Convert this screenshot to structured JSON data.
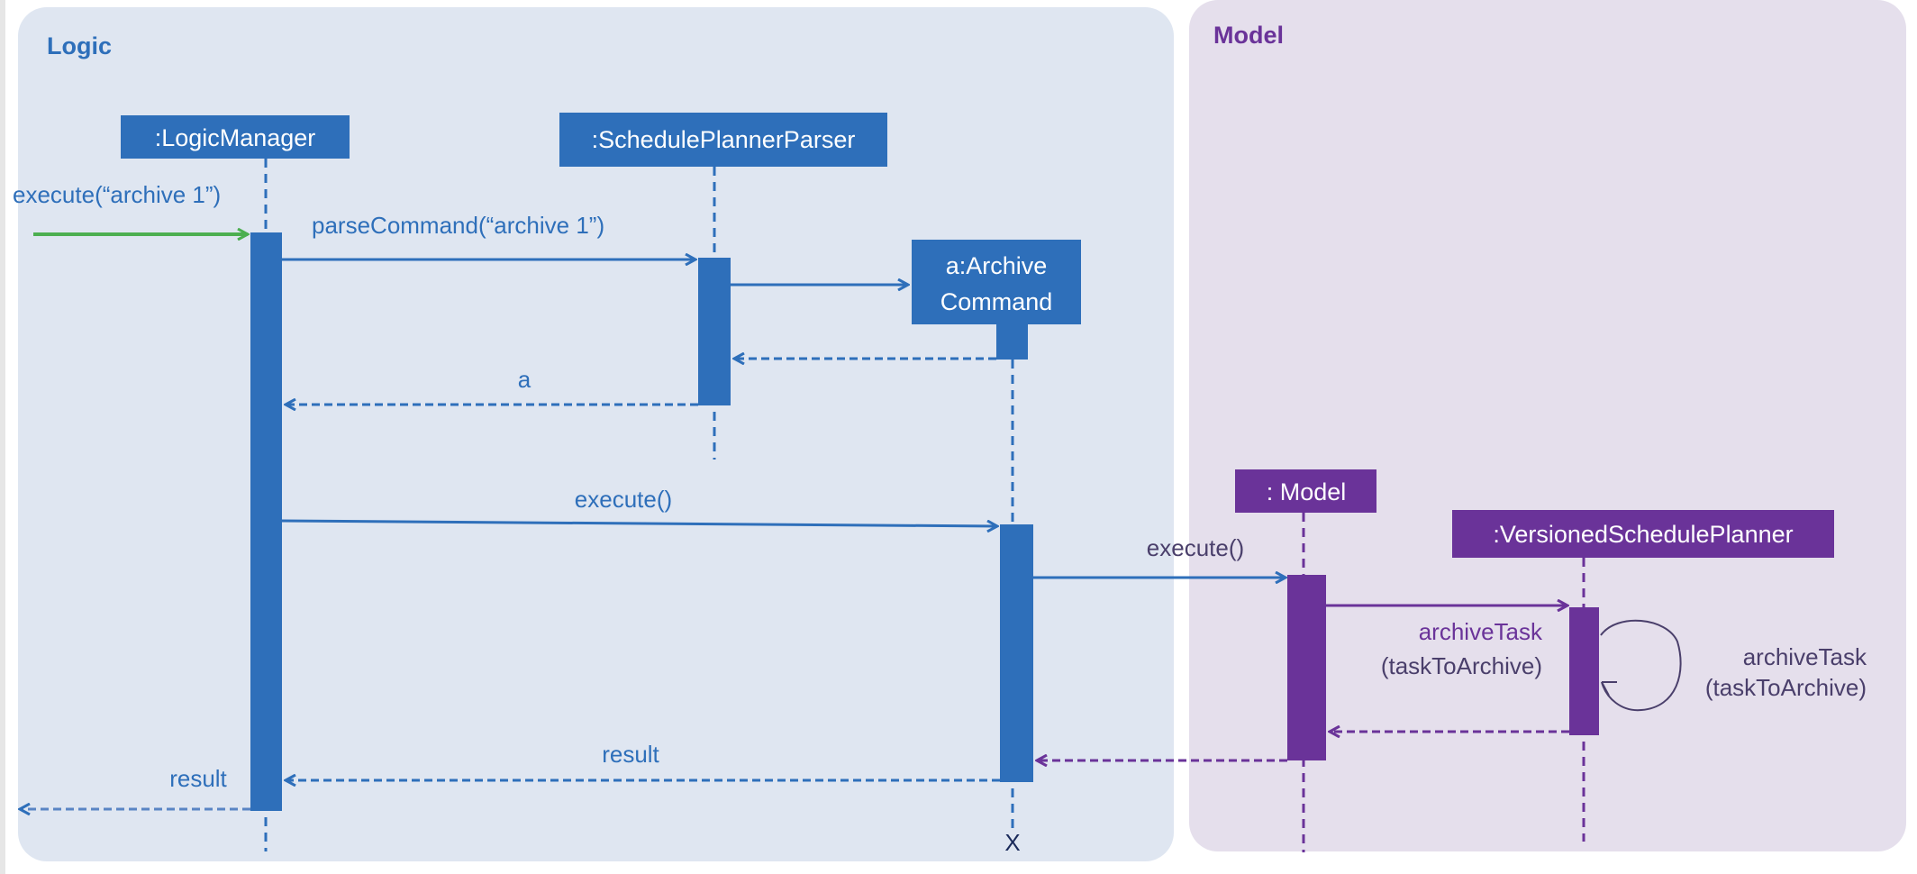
{
  "colors": {
    "logic": "#2e6fba",
    "model": "#6a3399",
    "call_in": "#4caf50",
    "logic_panel": "#dfe6f1",
    "model_panel": "#e5dfec",
    "label_dark": "#4a3f6b"
  },
  "panels": {
    "logic": "Logic",
    "model": "Model"
  },
  "lifelines": {
    "logic_manager": ":LogicManager",
    "parser": ":SchedulePlannerParser",
    "archive_line1": "a:Archive",
    "archive_line2": "Command",
    "model": ": Model",
    "versioned": ":VersionedSchedulePlanner"
  },
  "messages": {
    "execute_in": "execute(“archive 1”)",
    "parse": "parseCommand(“archive 1”)",
    "return_a": "a",
    "execute_cmd": "execute()",
    "execute_model": "execute()",
    "archive_task_1": "archiveTask",
    "archive_task_2": "(taskToArchive)",
    "self_task_1": "archiveTask",
    "self_task_2": "(taskToArchive)",
    "result_cmd": "result",
    "result_out": "result",
    "destroy": "X"
  }
}
